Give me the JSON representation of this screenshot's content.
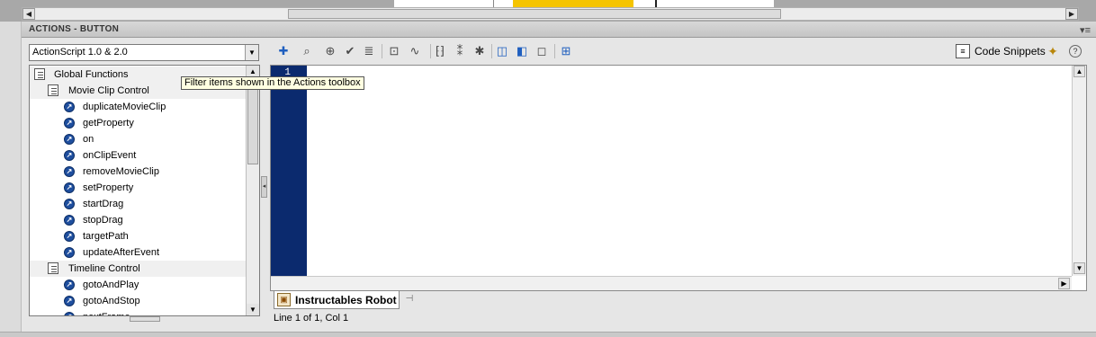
{
  "panel": {
    "title": "ACTIONS - BUTTON",
    "menu_icon": "panel-menu-icon"
  },
  "language_select": {
    "value": "ActionScript 1.0 & 2.0"
  },
  "toolbox": {
    "items": [
      {
        "label": "Global Functions",
        "kind": "folder",
        "depth": 0
      },
      {
        "label": "Movie Clip Control",
        "kind": "folder",
        "depth": 1
      },
      {
        "label": "duplicateMovieClip",
        "kind": "action",
        "depth": 2
      },
      {
        "label": "getProperty",
        "kind": "action",
        "depth": 2
      },
      {
        "label": "on",
        "kind": "action",
        "depth": 2
      },
      {
        "label": "onClipEvent",
        "kind": "action",
        "depth": 2
      },
      {
        "label": "removeMovieClip",
        "kind": "action",
        "depth": 2
      },
      {
        "label": "setProperty",
        "kind": "action",
        "depth": 2
      },
      {
        "label": "startDrag",
        "kind": "action",
        "depth": 2
      },
      {
        "label": "stopDrag",
        "kind": "action",
        "depth": 2
      },
      {
        "label": "targetPath",
        "kind": "action",
        "depth": 2
      },
      {
        "label": "updateAfterEvent",
        "kind": "action",
        "depth": 2
      },
      {
        "label": "Timeline Control",
        "kind": "folder",
        "depth": 1
      },
      {
        "label": "gotoAndPlay",
        "kind": "action",
        "depth": 2
      },
      {
        "label": "gotoAndStop",
        "kind": "action",
        "depth": 2
      },
      {
        "label": "nextFrame",
        "kind": "action",
        "depth": 2
      }
    ]
  },
  "tooltip": {
    "text": "Filter items shown in the Actions toolbox"
  },
  "toolbar": {
    "buttons": [
      "add-item-icon",
      "find-icon",
      "insert-target-path-icon",
      "check-syntax-icon",
      "auto-format-icon",
      "show-code-hint-icon",
      "debug-options-icon",
      "collapse-between-braces-icon",
      "collapse-selection-icon",
      "expand-all-icon",
      "apply-block-comment-icon",
      "apply-line-comment-icon",
      "remove-comment-icon",
      "show-hide-toolbox-icon"
    ],
    "code_snippets_label": "Code Snippets"
  },
  "editor": {
    "line_numbers": [
      "1"
    ]
  },
  "script_tab": {
    "label": "Instructables Robot"
  },
  "status": {
    "text": "Line 1 of 1, Col 1"
  }
}
